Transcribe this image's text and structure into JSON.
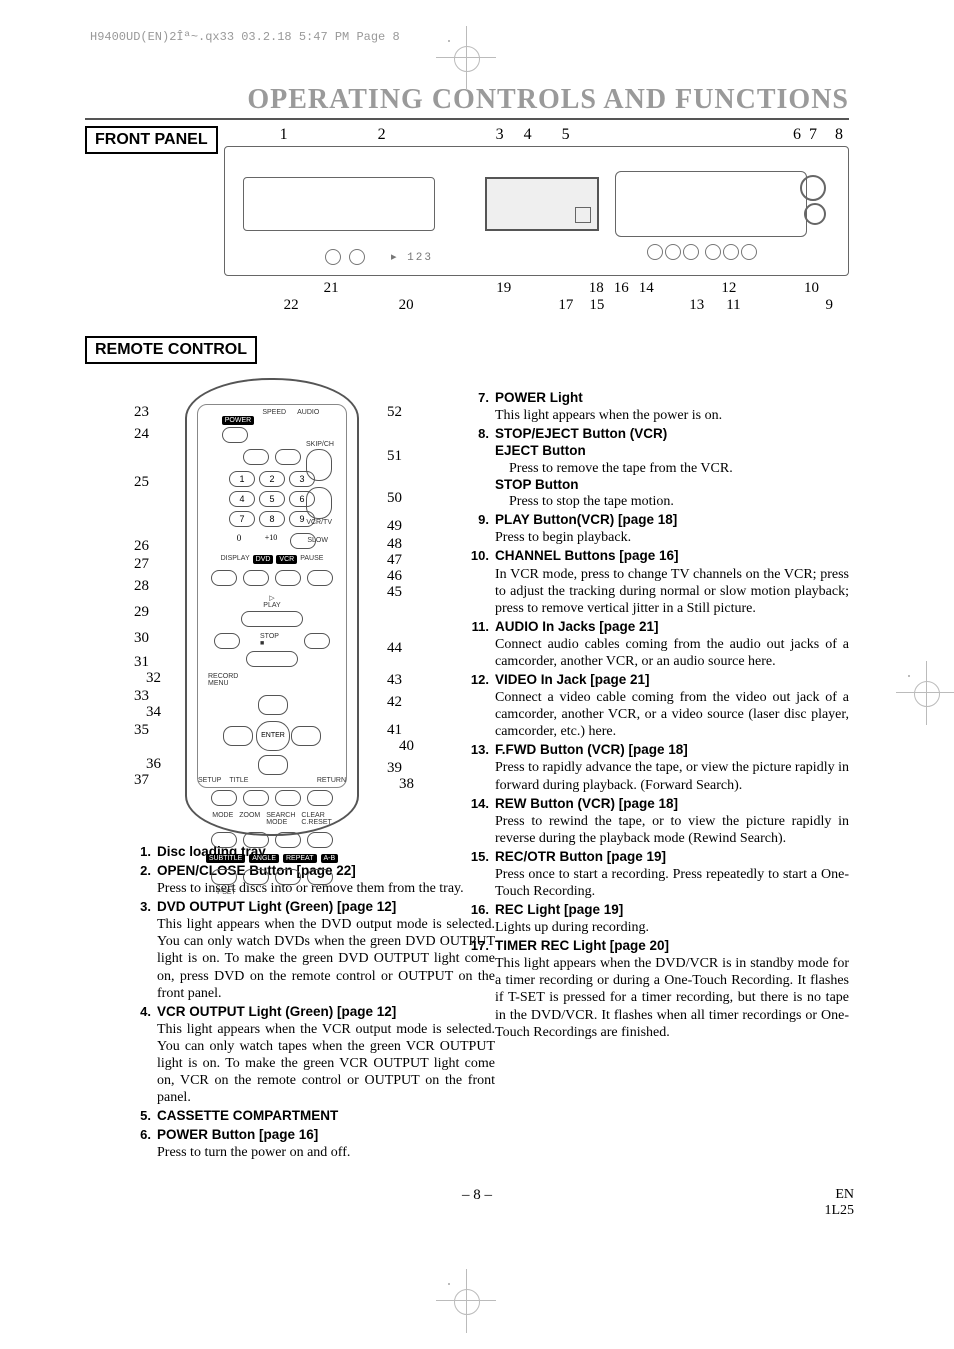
{
  "print_header": "H9400UD(EN)2Îª~.qx33  03.2.18 5:47 PM  Page 8",
  "title": "OPERATING CONTROLS AND FUNCTIONS",
  "front_panel_label": "FRONT PANEL",
  "front_panel_top": [
    "1",
    "2",
    "3",
    "4",
    "5",
    "6",
    "7",
    "8"
  ],
  "front_panel_bottom_a": [
    "21",
    "19",
    "18",
    "16",
    "14",
    "12",
    "10"
  ],
  "front_panel_bottom_b": [
    "22",
    "20",
    "17",
    "15",
    "13",
    "11",
    "9"
  ],
  "remote_label": "REMOTE CONTROL",
  "remote_left_nums": [
    "23",
    "24",
    "25",
    "26",
    "27",
    "28",
    "29",
    "30",
    "31",
    "32",
    "33",
    "34",
    "35",
    "36",
    "37"
  ],
  "remote_right_nums": [
    "52",
    "51",
    "50",
    "49",
    "48",
    "47",
    "46",
    "45",
    "44",
    "43",
    "42",
    "41",
    "40",
    "39",
    "38"
  ],
  "remote_keys": {
    "power": "POWER",
    "speed": "SPEED",
    "audio": "AUDIO",
    "skip": "SKIP/CH",
    "vcrtv": "VCR/TV",
    "slow": "SLOW",
    "display": "DISPLAY",
    "dvd": "DVD",
    "vcr": "VCR",
    "pause": "PAUSE",
    "play": "PLAY",
    "stop": "STOP",
    "record": "RECORD",
    "menu": "MENU",
    "enter": "ENTER",
    "setup": "SETUP",
    "title": "TITLE",
    "return": "RETURN",
    "mode": "MODE",
    "zoom": "ZOOM",
    "search_mode": "SEARCH\nMODE",
    "clear": "CLEAR\nC.RESET",
    "subtitle": "SUBTITLE",
    "angle": "ANGLE",
    "repeat": "REPEAT",
    "ab": "A-B",
    "tset": "T-SET",
    "n1": "1",
    "n2": "2",
    "n3": "3",
    "n4": "4",
    "n5": "5",
    "n6": "6",
    "n7": "7",
    "n8": "8",
    "n9": "9",
    "n0": "0",
    "n10": "+10"
  },
  "items_left": [
    {
      "n": "1.",
      "t": "Disc loading tray",
      "d": ""
    },
    {
      "n": "2.",
      "t": "OPEN/CLOSE Button [page 22]",
      "d": "Press to insert discs into or remove them from the tray."
    },
    {
      "n": "3.",
      "t": "DVD OUTPUT Light (Green) [page 12]",
      "d": "This light appears when the DVD output mode is selected. You can only watch DVDs when the green DVD OUTPUT light is on. To make the green DVD OUTPUT light come on, press DVD on the remote control or OUTPUT on the front panel."
    },
    {
      "n": "4.",
      "t": "VCR OUTPUT Light (Green) [page 12]",
      "d": "This light appears when the VCR output mode is selected. You can only watch tapes when the green VCR OUTPUT light is on. To make the green VCR OUTPUT light come on, VCR on the remote control or OUTPUT on the front panel."
    },
    {
      "n": "5.",
      "t": "CASSETTE COMPARTMENT",
      "d": ""
    },
    {
      "n": "6.",
      "t": "POWER Button [page 16]",
      "d": "Press to turn the power on and off."
    }
  ],
  "items_right": [
    {
      "n": "7.",
      "t": "POWER Light",
      "d": "This light appears when the power is on."
    },
    {
      "n": "8.",
      "t": "STOP/EJECT Button (VCR)",
      "sub": [
        {
          "t2": "EJECT Button",
          "d": "Press to remove the tape from the VCR."
        },
        {
          "t2": "STOP Button",
          "d": "Press to stop the tape motion."
        }
      ]
    },
    {
      "n": "9.",
      "t": "PLAY Button(VCR) [page 18]",
      "d": "Press to begin playback."
    },
    {
      "n": "10.",
      "t": "CHANNEL Buttons [page 16]",
      "d": "In VCR mode, press to change TV channels on the VCR; press to adjust the tracking during normal or slow motion playback; press to remove vertical jitter in a Still picture."
    },
    {
      "n": "11.",
      "t": "AUDIO In Jacks [page 21]",
      "d": "Connect audio cables coming from the audio out jacks of a camcorder, another VCR, or an audio source here."
    },
    {
      "n": "12.",
      "t": "VIDEO In Jack [page 21]",
      "d": "Connect a video cable coming from the video out jack of a camcorder, another VCR, or a video source (laser disc player, camcorder, etc.) here."
    },
    {
      "n": "13.",
      "t": "F.FWD Button (VCR) [page 18]",
      "d": "Press to rapidly advance the tape, or view the picture rapidly in forward during playback. (Forward Search)."
    },
    {
      "n": "14.",
      "t": "REW Button (VCR) [page 18]",
      "d": "Press to rewind the tape, or to view the picture rapidly in reverse during the playback mode (Rewind Search)."
    },
    {
      "n": "15.",
      "t": "REC/OTR Button [page 19]",
      "d": "Press once to start a recording. Press repeatedly to start a One-Touch Recording."
    },
    {
      "n": "16.",
      "t": "REC Light [page 19]",
      "d": "Lights up during recording."
    },
    {
      "n": "17.",
      "t": "TIMER REC Light [page 20]",
      "d": "This light appears when the DVD/VCR is in standby mode for a timer recording or during a One-Touch Recording. It flashes if T-SET is pressed for a timer recording, but there is no tape in the DVD/VCR. It flashes when all timer recordings or One-Touch Recordings are finished."
    }
  ],
  "page_number": "– 8 –",
  "footer_right_1": "EN",
  "footer_right_2": "1L25"
}
